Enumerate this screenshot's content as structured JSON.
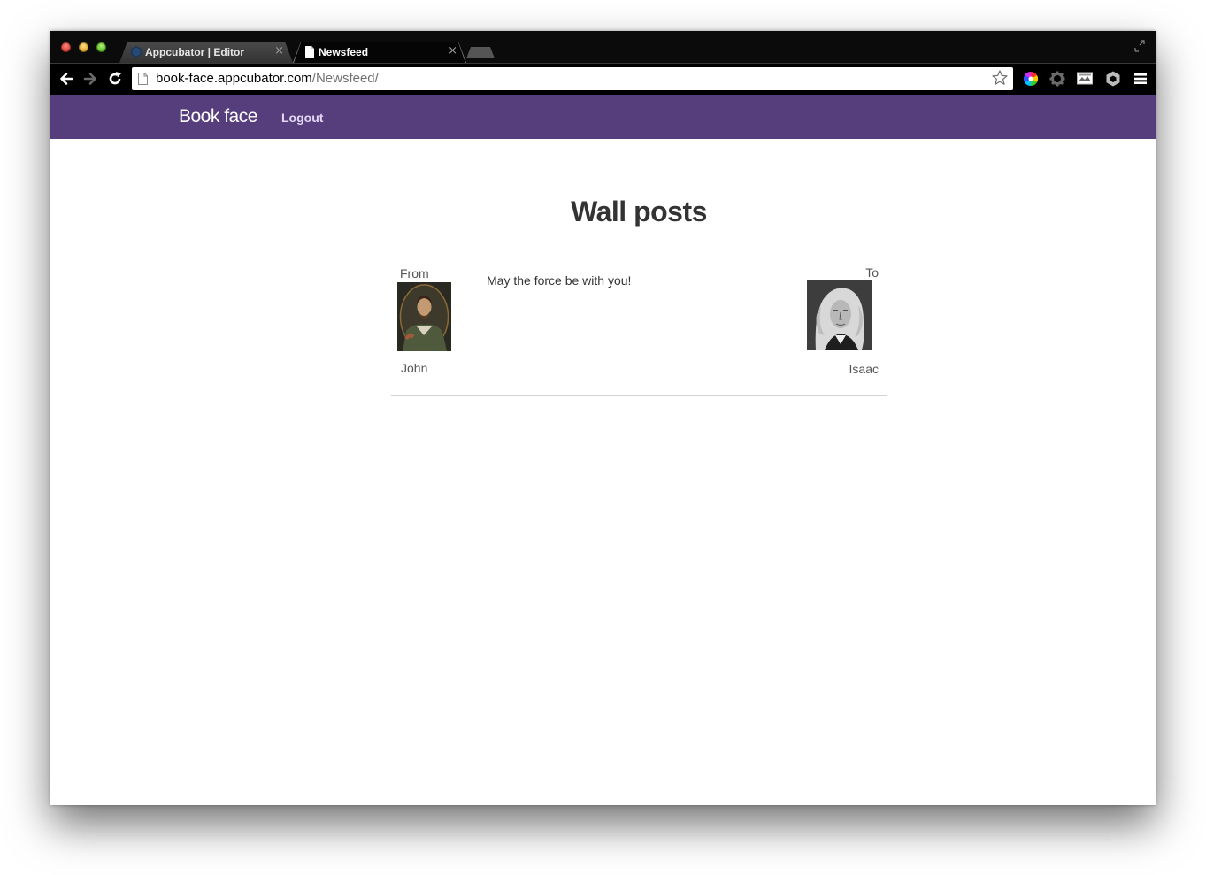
{
  "browser": {
    "tabs": [
      {
        "title": "Appcubator | Editor",
        "active": false
      },
      {
        "title": "Newsfeed",
        "active": true
      }
    ],
    "close_glyph": "×",
    "url_host": "book-face.appcubator.com",
    "url_path": "/Newsfeed/"
  },
  "navbar": {
    "brand": "Book face",
    "logout_label": "Logout",
    "color": "#563d7c"
  },
  "main": {
    "heading": "Wall posts",
    "posts": [
      {
        "from_label": "From",
        "from_name": "John",
        "message": "May the force be with you!",
        "to_label": "To",
        "to_name": "Isaac"
      }
    ]
  }
}
